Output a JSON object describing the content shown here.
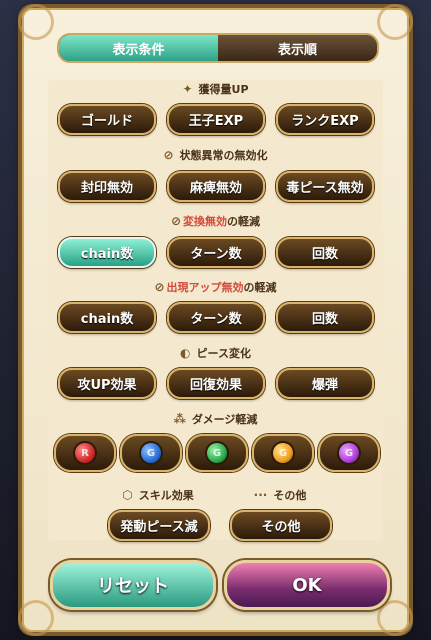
{
  "tabs": [
    {
      "label": "表示条件",
      "active": true
    },
    {
      "label": "表示順",
      "active": false
    }
  ],
  "sections": {
    "gain": {
      "title": "獲得量UP",
      "buttons": [
        "ゴールド",
        "王子EXP",
        "ランクEXP"
      ]
    },
    "status": {
      "title": "状態異常の無効化",
      "buttons": [
        "封印無効",
        "麻痺無効",
        "毒ピース無効"
      ]
    },
    "transform": {
      "title_red": "変換無効",
      "title_rest": "の軽減",
      "buttons": [
        "chain数",
        "ターン数",
        "回数"
      ]
    },
    "appear": {
      "title_red": "出現アップ無効",
      "title_rest": "の軽減",
      "buttons": [
        "chain数",
        "ターン数",
        "回数"
      ]
    },
    "piece": {
      "title": "ピース変化",
      "buttons": [
        "攻UP効果",
        "回復効果",
        "爆弾"
      ]
    },
    "damage": {
      "title": "ダメージ軽減",
      "orbs": [
        {
          "letter": "R",
          "color": "#d22a2a"
        },
        {
          "letter": "G",
          "color": "#2a6fd8"
        },
        {
          "letter": "G",
          "color": "#2fae4e"
        },
        {
          "letter": "G",
          "color": "#f0a020"
        },
        {
          "letter": "G",
          "color": "#b040d8"
        }
      ]
    },
    "skill": {
      "title": "スキル効果",
      "button": "発動ピース減"
    },
    "other": {
      "title": "その他",
      "button": "その他"
    }
  },
  "actions": {
    "reset": "リセット",
    "ok": "OK"
  },
  "colors": {
    "active_teal": "#2ea187",
    "ok_pink": "#f07fb0",
    "panel": "#f8f0dc"
  }
}
